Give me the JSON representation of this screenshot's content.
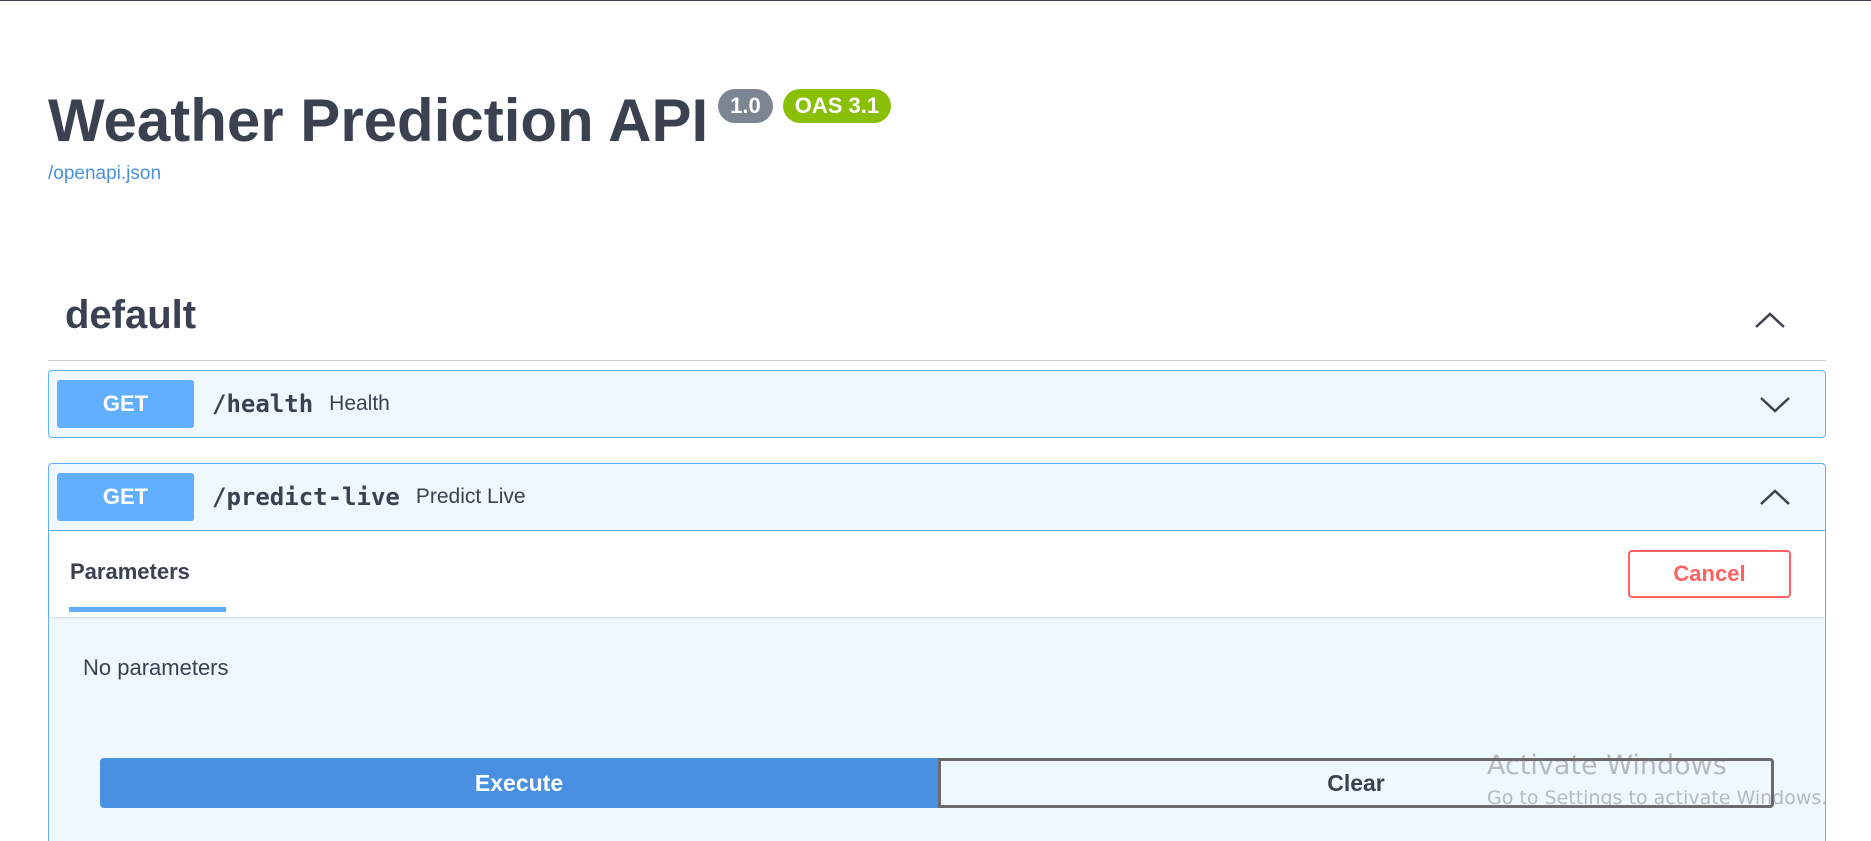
{
  "info": {
    "title": "Weather Prediction API",
    "version": "1.0",
    "oas_version": "OAS 3.1",
    "spec_link": "/openapi.json"
  },
  "tag": {
    "name": "default",
    "toggle_icon": "chevron-up-icon"
  },
  "operations": [
    {
      "method": "GET",
      "path": "/health",
      "summary": "Health",
      "expanded": false,
      "chevron_icon": "chevron-down-icon"
    },
    {
      "method": "GET",
      "path": "/predict-live",
      "summary": "Predict Live",
      "expanded": true,
      "chevron_icon": "chevron-up-icon",
      "tab_label": "Parameters",
      "cancel_label": "Cancel",
      "no_params_text": "No parameters",
      "execute_label": "Execute",
      "clear_label": "Clear"
    }
  ],
  "watermark": {
    "title": "Activate Windows",
    "subtitle": "Go to Settings to activate Windows."
  },
  "colors": {
    "get_method": "#61affe",
    "execute": "#4990e2",
    "cancel": "#ff6060",
    "oas_badge": "#89bf04",
    "version_badge": "#7d8492",
    "link": "#4990e2"
  }
}
